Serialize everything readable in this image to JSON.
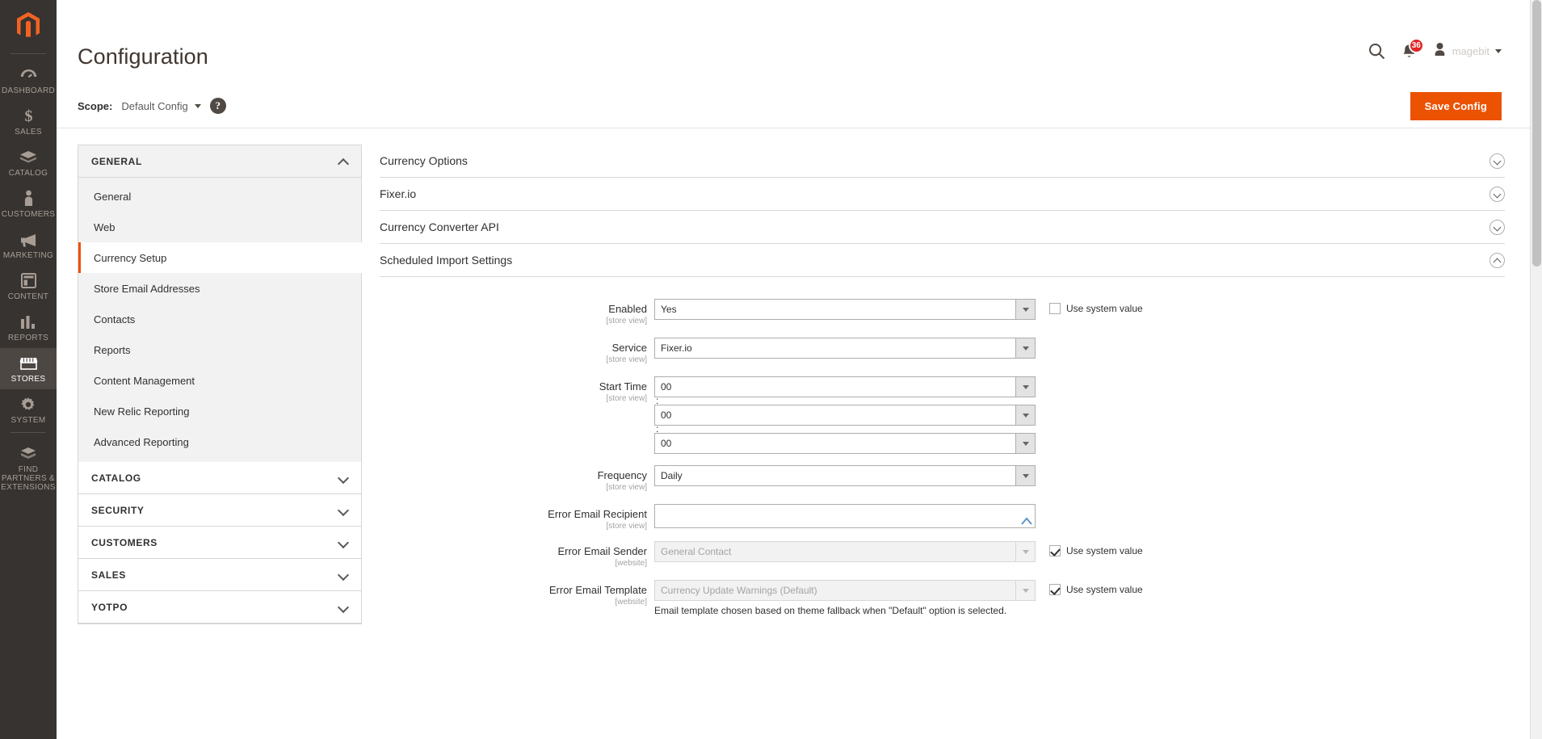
{
  "admin_nav": {
    "logo_icon": "magento-logo-icon",
    "items": [
      {
        "label": "Dashboard",
        "icon": "dashboard-icon",
        "active": false
      },
      {
        "label": "Sales",
        "icon": "sales-dollar-icon",
        "active": false
      },
      {
        "label": "Catalog",
        "icon": "catalog-box-icon",
        "active": false
      },
      {
        "label": "Customers",
        "icon": "customers-person-icon",
        "active": false
      },
      {
        "label": "Marketing",
        "icon": "marketing-megaphone-icon",
        "active": false
      },
      {
        "label": "Content",
        "icon": "content-layout-icon",
        "active": false
      },
      {
        "label": "Reports",
        "icon": "reports-bars-icon",
        "active": false
      },
      {
        "label": "Stores",
        "icon": "stores-shop-icon",
        "active": true
      },
      {
        "label": "System",
        "icon": "system-gear-icon",
        "active": false
      },
      {
        "label": "Find Partners\n& Extensions",
        "icon": "extensions-box-icon",
        "active": false
      }
    ]
  },
  "header": {
    "title": "Configuration",
    "search_icon": "search-icon",
    "notifications_icon": "bell-icon",
    "notifications_count": "36",
    "user_icon": "user-avatar-icon",
    "user_name": "magebit",
    "user_caret_icon": "caret-down-icon"
  },
  "scope_bar": {
    "label": "Scope:",
    "value": "Default Config",
    "caret_icon": "caret-down-icon",
    "help_icon": "question-mark-icon",
    "help_glyph": "?",
    "save_label": "Save Config",
    "save_color": "#eb5202"
  },
  "config_nav": {
    "sections": [
      {
        "title": "General",
        "expanded": true,
        "items": [
          {
            "label": "General",
            "active": false
          },
          {
            "label": "Web",
            "active": false
          },
          {
            "label": "Currency Setup",
            "active": true
          },
          {
            "label": "Store Email Addresses",
            "active": false
          },
          {
            "label": "Contacts",
            "active": false
          },
          {
            "label": "Reports",
            "active": false
          },
          {
            "label": "Content Management",
            "active": false
          },
          {
            "label": "New Relic Reporting",
            "active": false
          },
          {
            "label": "Advanced Reporting",
            "active": false
          }
        ]
      },
      {
        "title": "Catalog",
        "expanded": false,
        "items": []
      },
      {
        "title": "Security",
        "expanded": false,
        "items": []
      },
      {
        "title": "Customers",
        "expanded": false,
        "items": []
      },
      {
        "title": "Sales",
        "expanded": false,
        "items": []
      },
      {
        "title": "Yotpo",
        "expanded": false,
        "items": []
      }
    ]
  },
  "settings": {
    "accordions": [
      {
        "title": "Currency Options",
        "expanded": false
      },
      {
        "title": "Fixer.io",
        "expanded": false
      },
      {
        "title": "Currency Converter API",
        "expanded": false
      },
      {
        "title": "Scheduled Import Settings",
        "expanded": true
      }
    ],
    "fields": {
      "enabled": {
        "label": "Enabled",
        "scope": "[store view]",
        "value": "Yes",
        "use_system_value_label": "Use system value",
        "use_system_value_checked": false
      },
      "service": {
        "label": "Service",
        "scope": "[store view]",
        "value": "Fixer.io"
      },
      "start_time": {
        "label": "Start Time",
        "scope": "[store view]",
        "hours": "00",
        "minutes": "00",
        "seconds": "00",
        "separator": ":"
      },
      "frequency": {
        "label": "Frequency",
        "scope": "[store view]",
        "value": "Daily"
      },
      "error_email_recipient": {
        "label": "Error Email Recipient",
        "scope": "[store view]",
        "value": "",
        "placeholder": "",
        "resize_icon": "resize-handle-icon"
      },
      "error_email_sender": {
        "label": "Error Email Sender",
        "scope": "[website]",
        "value": "General Contact",
        "disabled": true,
        "use_system_value_label": "Use system value",
        "use_system_value_checked": true
      },
      "error_email_template": {
        "label": "Error Email Template",
        "scope": "[website]",
        "value": "Currency Update Warnings (Default)",
        "disabled": true,
        "note": "Email template chosen based on theme fallback when \"Default\" option is selected.",
        "use_system_value_label": "Use system value",
        "use_system_value_checked": true
      }
    }
  }
}
